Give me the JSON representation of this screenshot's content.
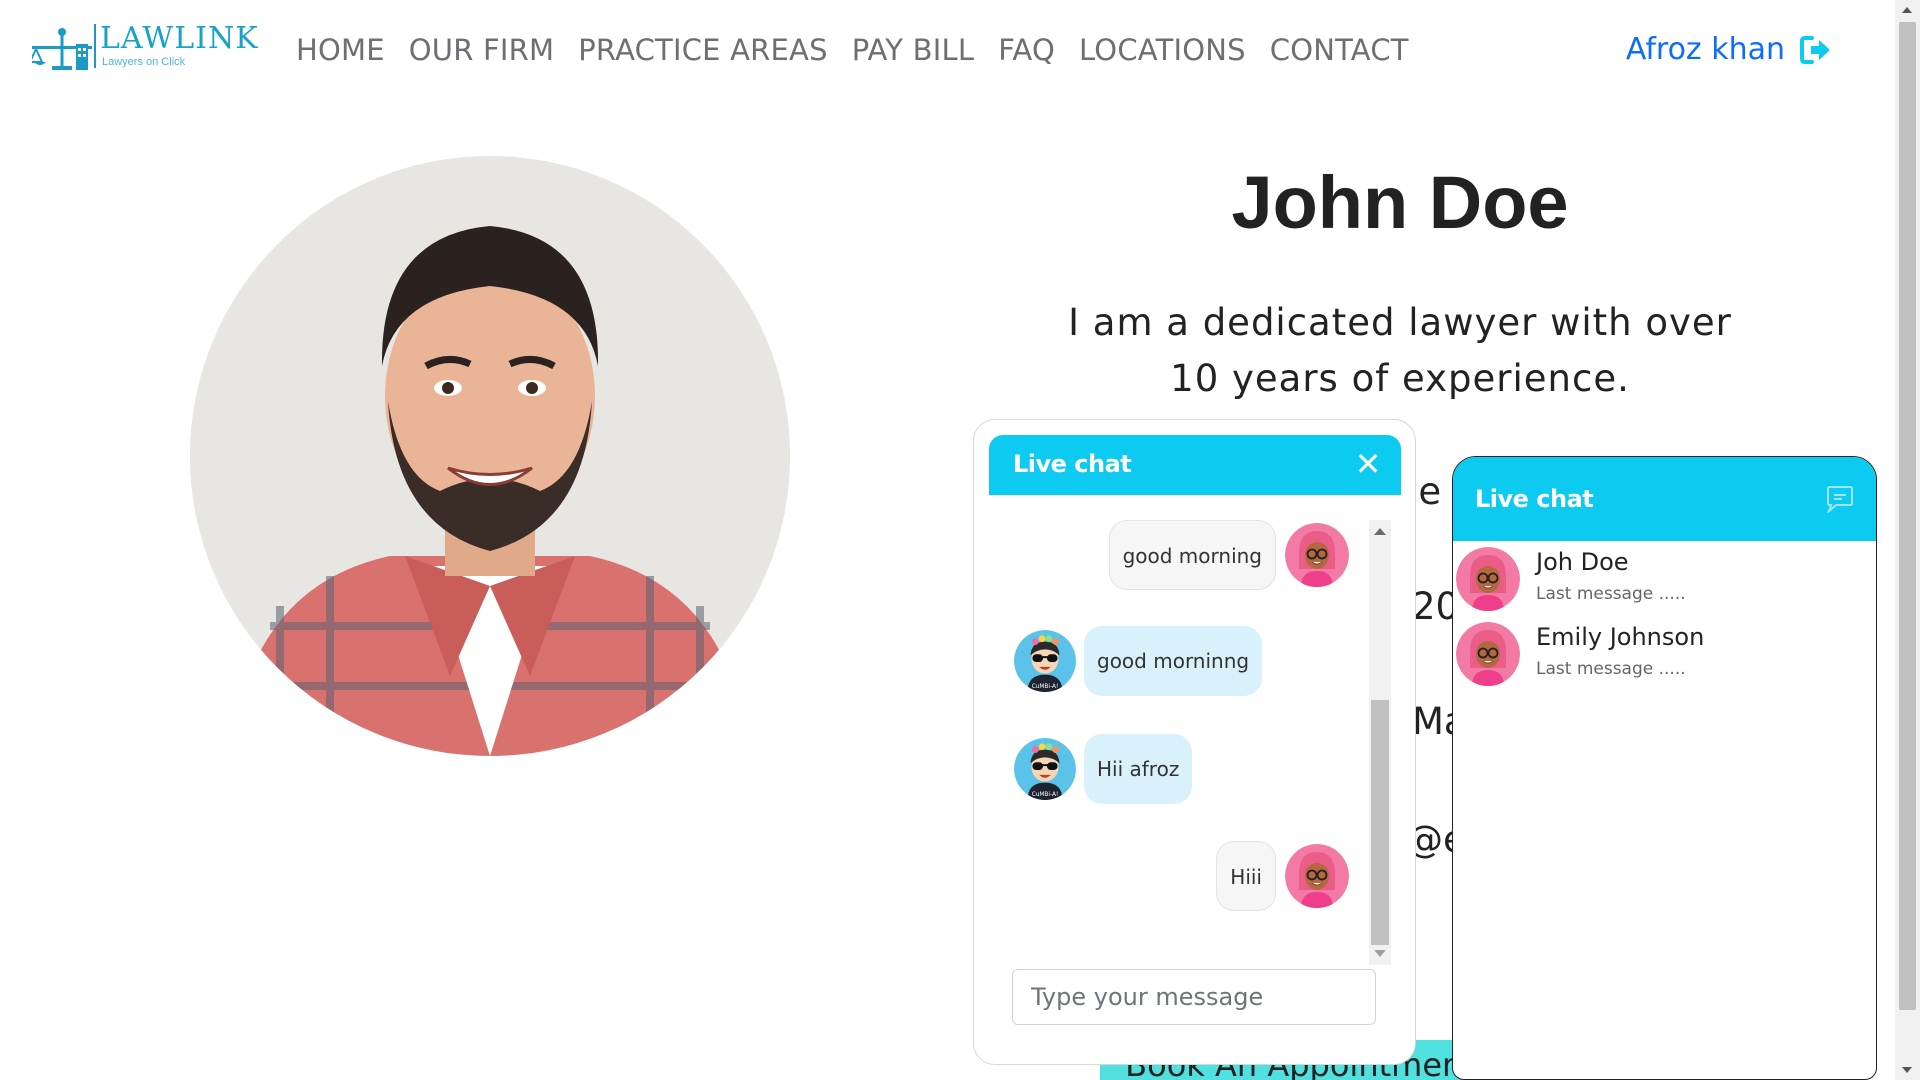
{
  "brand": {
    "title": "LAWLINK",
    "subtitle": "Lawyers on Click",
    "color": "#17a2c7"
  },
  "nav": {
    "items": [
      {
        "label": "HOME"
      },
      {
        "label": "OUR FIRM"
      },
      {
        "label": "PRACTICE AREAS"
      },
      {
        "label": "PAY BILL"
      },
      {
        "label": "FAQ"
      },
      {
        "label": "LOCATIONS"
      },
      {
        "label": "CONTACT"
      }
    ],
    "user_name": "Afroz khan",
    "logout_icon": "sign-out-icon"
  },
  "profile": {
    "name": "John Doe",
    "bio_line1": "I am a dedicated lawyer with over",
    "bio_line2": "10 years of experience.",
    "fragment_1": "ce",
    "fragment_2": "20",
    "fragment_3": "Ma",
    "fragment_4": "@e",
    "book_button": "Book An Appointment"
  },
  "chat": {
    "title": "Live chat",
    "close_icon": "close-icon",
    "messages": [
      {
        "text": "good morning",
        "from": "me"
      },
      {
        "text": "good morninng",
        "from": "them"
      },
      {
        "text": "Hii afroz",
        "from": "them"
      },
      {
        "text": "Hiii",
        "from": "me"
      }
    ],
    "input_placeholder": "Type your message",
    "scroll_position": 0.55
  },
  "contacts": {
    "title": "Live chat",
    "header_icon": "chat-bubble-icon",
    "items": [
      {
        "name": "Joh Doe",
        "last": "Last message ....."
      },
      {
        "name": "Emily Johnson",
        "last": "Last message ....."
      }
    ]
  },
  "colors": {
    "accent": "#0dcaf0",
    "user_link": "#0d6efd",
    "bubble_them": "#d9f1fb",
    "book_button": "#4fe0df"
  }
}
